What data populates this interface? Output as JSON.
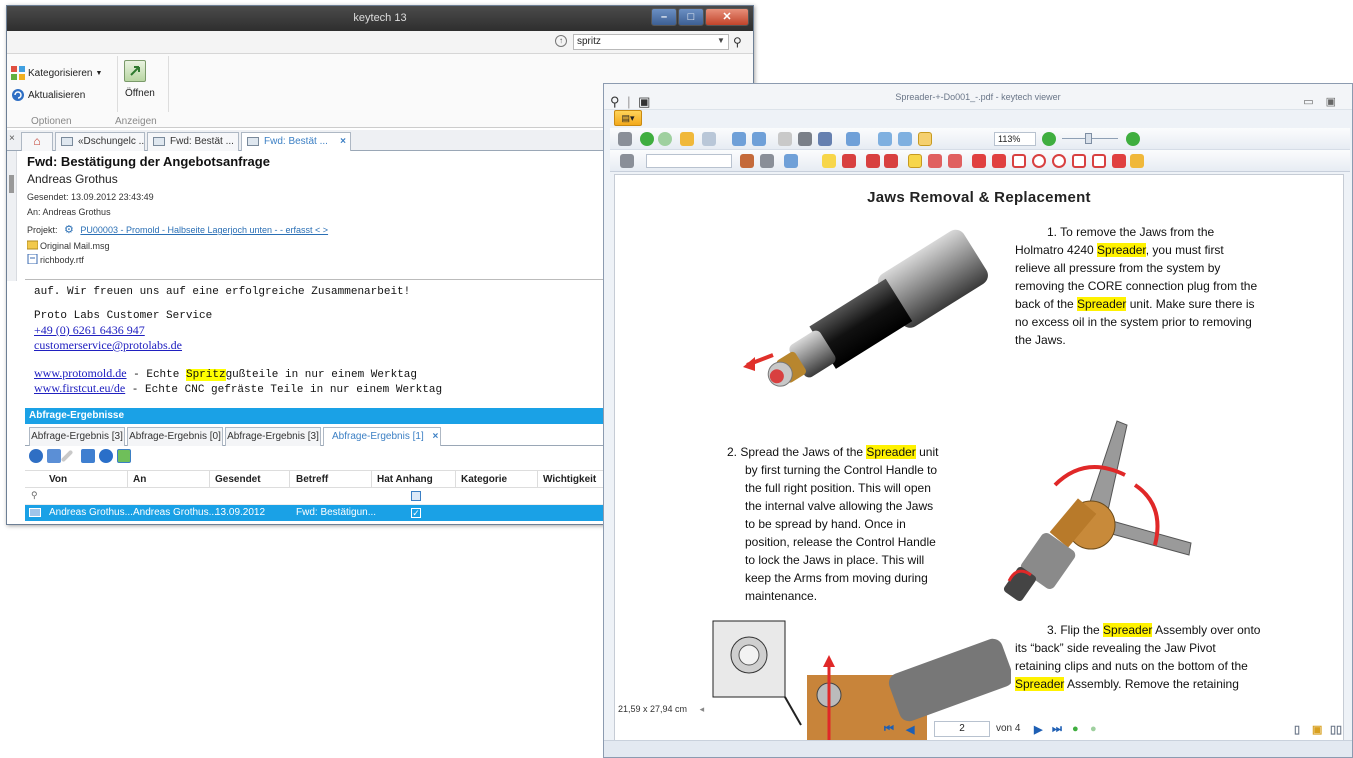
{
  "left_window": {
    "title": "keytech 13",
    "search": {
      "value": "spritz"
    },
    "ribbon": {
      "kategorisieren": "Kategorisieren",
      "aktualisieren": "Aktualisieren",
      "oeffnen": "Öffnen",
      "group_optionen": "Optionen",
      "group_anzeigen": "Anzeigen"
    },
    "doc_tabs": [
      {
        "label": "«Dschungelc ..."
      },
      {
        "label": "Fwd: Bestät ..."
      },
      {
        "label": "Fwd: Bestät ..."
      }
    ],
    "mail": {
      "subject": "Fwd: Bestätigung der Angebotsanfrage",
      "from": "Andreas Grothus",
      "sent_label": "Gesendet:",
      "sent_value": "13.09.2012 23:43:49",
      "to_label": "An:",
      "to_value": "Andreas Grothus",
      "project_label": "Projekt:",
      "project_value": "PU00003 - Promold - Halbseite Lagerjoch unten -  - erfasst < >",
      "attachment1": "Original Mail.msg",
      "attachment2": "richbody.rtf",
      "body_line1": "auf. Wir freuen uns auf eine erfolgreiche Zusammenarbeit!",
      "body_line2": "Proto Labs Customer Service",
      "phone": "+49 (0) 6261 6436 947",
      "email": "customerservice@protolabs.de",
      "link1": "www.protomold.de",
      "link1_rest_a": " - Echte ",
      "link1_hl": "Spritz",
      "link1_rest_b": "gußteile in nur einem Werktag",
      "link2": "www.firstcut.eu/de",
      "link2_rest": " - Echte CNC gefräste Teile in nur einem Werktag"
    },
    "results": {
      "header": "Abfrage-Ergebnisse",
      "tabs": [
        "Abfrage-Ergebnis [3]",
        "Abfrage-Ergebnis [0]",
        "Abfrage-Ergebnis [3]",
        "Abfrage-Ergebnis [1]"
      ],
      "columns": [
        "Von",
        "An",
        "Gesendet",
        "Betreff",
        "Hat Anhang",
        "Kategorie",
        "Wichtigkeit"
      ],
      "row": {
        "von": "Andreas Grothus...",
        "an": "Andreas Grothus...",
        "gesendet": "13.09.2012",
        "betreff": "Fwd: Bestätigun...",
        "hat_anhang": true
      }
    }
  },
  "right_window": {
    "title": "Spreader-+-Do001_-.pdf - keytech viewer",
    "zoom": "113%",
    "document": {
      "heading": "Jaws Removal & Replacement",
      "step1_a": "1.   To remove the Jaws from the",
      "step1_b": "Holmatro 4240 ",
      "step1_c": ", you must first",
      "step1_d": "relieve all pressure from the system by",
      "step1_e": "removing the CORE connection plug from the",
      "step1_f": "back of the ",
      "step1_g": " unit.  Make sure there is",
      "step1_h": "no excess oil in the system prior to removing",
      "step1_i": "the Jaws.",
      "spreader": "Spreader",
      "step2_a": "2.   Spread the Jaws of the ",
      "step2_b": " unit",
      "step2_c": "by first turning the Control Handle to",
      "step2_d": "the full right position.  This will open",
      "step2_e": "the internal valve allowing the Jaws",
      "step2_f": "to be spread by hand.  Once in",
      "step2_g": "position, release the Control Handle",
      "step2_h": "to lock the Jaws in place.  This will",
      "step2_i": "keep the Arms from moving during",
      "step2_j": "maintenance.",
      "step3_a": "3.   Flip the ",
      "step3_b": " Assembly over onto",
      "step3_c": "its “back” side revealing the Jaw Pivot",
      "step3_d": "retaining clips and nuts on the bottom of the",
      "step3_e": " Assembly.  Remove the retaining"
    },
    "status_size": "21,59 x 27,94 cm",
    "page_current": "2",
    "page_of": "von 4"
  }
}
